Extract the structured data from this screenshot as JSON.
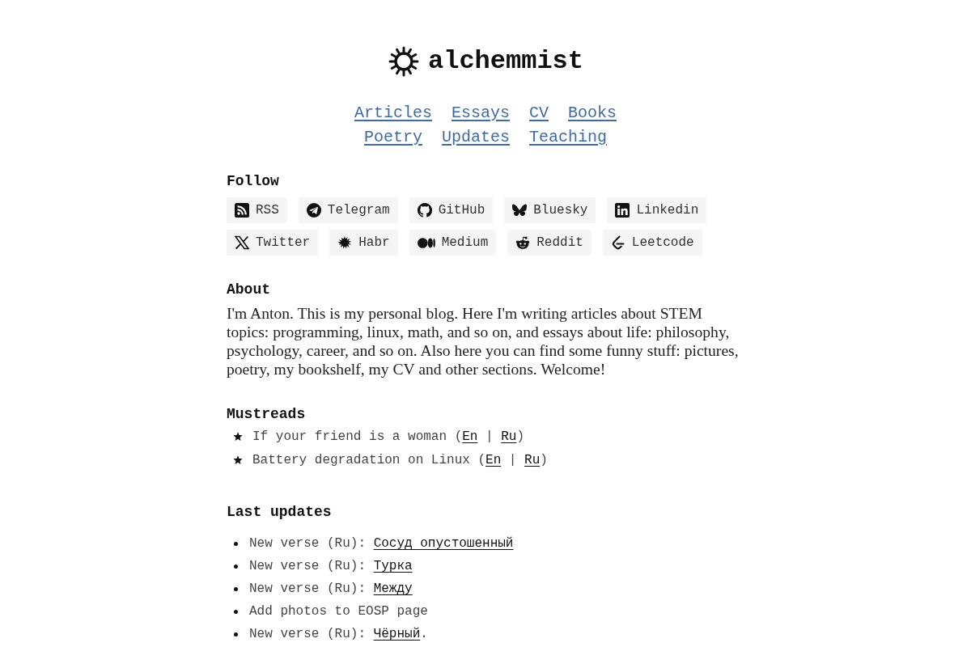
{
  "header": {
    "title": "alchemmist"
  },
  "nav": {
    "rows": [
      [
        "Articles",
        "Essays",
        "CV",
        "Books"
      ],
      [
        "Poetry",
        "Updates",
        "Teaching"
      ]
    ]
  },
  "follow": {
    "heading": "Follow",
    "links": [
      "RSS",
      "Telegram",
      "GitHub",
      "Bluesky",
      "Linkedin",
      "Twitter",
      "Habr",
      "Medium",
      "Reddit",
      "Leetcode"
    ]
  },
  "about": {
    "heading": "About",
    "text": "I'm Anton. This is my personal blog. Here I'm writing articles about STEM topics: programming, linux, math, and so on, and essays about life: philosophy, psychology, career, and so on. Also here you can find some funny stuff: pictures, poetry, my bookshelf, my CV and other sections. Welcome!"
  },
  "mustreads": {
    "heading": "Mustreads",
    "items": [
      {
        "parts": [
          {
            "kind": "text",
            "text": "If your friend is a woman ("
          },
          {
            "kind": "link",
            "text": "En"
          },
          {
            "kind": "text",
            "text": " | "
          },
          {
            "kind": "link",
            "text": "Ru"
          },
          {
            "kind": "text",
            "text": ")"
          }
        ]
      },
      {
        "parts": [
          {
            "kind": "text",
            "text": "Battery degradation on Linux ("
          },
          {
            "kind": "link",
            "text": "En"
          },
          {
            "kind": "text",
            "text": " | "
          },
          {
            "kind": "link",
            "text": "Ru"
          },
          {
            "kind": "text",
            "text": ")"
          }
        ]
      }
    ]
  },
  "last_updates": {
    "heading": "Last updates",
    "items": [
      {
        "parts": [
          {
            "kind": "text",
            "text": "New verse (Ru): "
          },
          {
            "kind": "link",
            "text": "Сосуд опустошенный"
          }
        ]
      },
      {
        "parts": [
          {
            "kind": "text",
            "text": "New verse (Ru): "
          },
          {
            "kind": "link",
            "text": "Турка"
          }
        ]
      },
      {
        "parts": [
          {
            "kind": "text",
            "text": "New verse (Ru): "
          },
          {
            "kind": "link",
            "text": "Между"
          }
        ]
      },
      {
        "parts": [
          {
            "kind": "text",
            "text": "Add photos to EOSP page"
          }
        ]
      },
      {
        "parts": [
          {
            "kind": "text",
            "text": "New verse (Ru): "
          },
          {
            "kind": "link",
            "text": "Чёрный"
          },
          {
            "kind": "text",
            "text": "."
          }
        ]
      }
    ]
  }
}
